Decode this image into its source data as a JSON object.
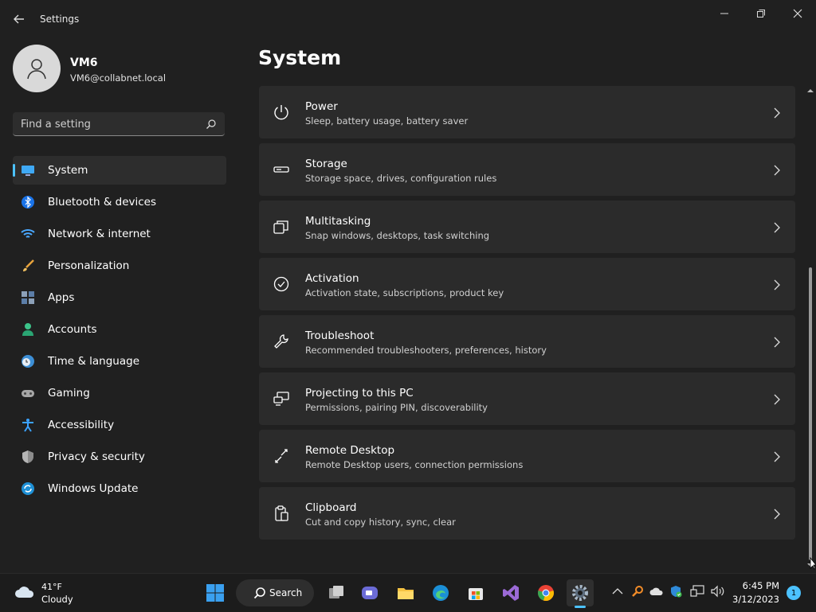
{
  "window": {
    "title": "Settings"
  },
  "profile": {
    "name": "VM6",
    "email": "VM6@collabnet.local"
  },
  "search": {
    "placeholder": "Find a setting"
  },
  "nav": {
    "items": [
      {
        "label": "System",
        "icon": "monitor-icon",
        "active": true
      },
      {
        "label": "Bluetooth & devices",
        "icon": "bluetooth-icon"
      },
      {
        "label": "Network & internet",
        "icon": "wifi-icon"
      },
      {
        "label": "Personalization",
        "icon": "brush-icon"
      },
      {
        "label": "Apps",
        "icon": "apps-icon"
      },
      {
        "label": "Accounts",
        "icon": "person-icon"
      },
      {
        "label": "Time & language",
        "icon": "clock-globe-icon"
      },
      {
        "label": "Gaming",
        "icon": "controller-icon"
      },
      {
        "label": "Accessibility",
        "icon": "accessibility-icon"
      },
      {
        "label": "Privacy & security",
        "icon": "shield-icon"
      },
      {
        "label": "Windows Update",
        "icon": "update-icon"
      }
    ]
  },
  "main": {
    "title": "System",
    "cards": [
      {
        "title": "Power",
        "subtitle": "Sleep, battery usage, battery saver",
        "icon": "power-icon"
      },
      {
        "title": "Storage",
        "subtitle": "Storage space, drives, configuration rules",
        "icon": "drive-icon"
      },
      {
        "title": "Multitasking",
        "subtitle": "Snap windows, desktops, task switching",
        "icon": "multitasking-icon"
      },
      {
        "title": "Activation",
        "subtitle": "Activation state, subscriptions, product key",
        "icon": "check-circle-icon"
      },
      {
        "title": "Troubleshoot",
        "subtitle": "Recommended troubleshooters, preferences, history",
        "icon": "wrench-icon"
      },
      {
        "title": "Projecting to this PC",
        "subtitle": "Permissions, pairing PIN, discoverability",
        "icon": "projecting-icon"
      },
      {
        "title": "Remote Desktop",
        "subtitle": "Remote Desktop users, connection permissions",
        "icon": "remote-desktop-icon"
      },
      {
        "title": "Clipboard",
        "subtitle": "Cut and copy history, sync, clear",
        "icon": "clipboard-icon"
      }
    ]
  },
  "taskbar": {
    "weather": {
      "temp": "41°F",
      "desc": "Cloudy"
    },
    "search_label": "Search",
    "clock": {
      "time": "6:45 PM",
      "date": "3/12/2023"
    },
    "notification_count": "1"
  },
  "colors": {
    "accent": "#4cc2ff",
    "background": "#202020",
    "card": "#2b2b2b"
  }
}
